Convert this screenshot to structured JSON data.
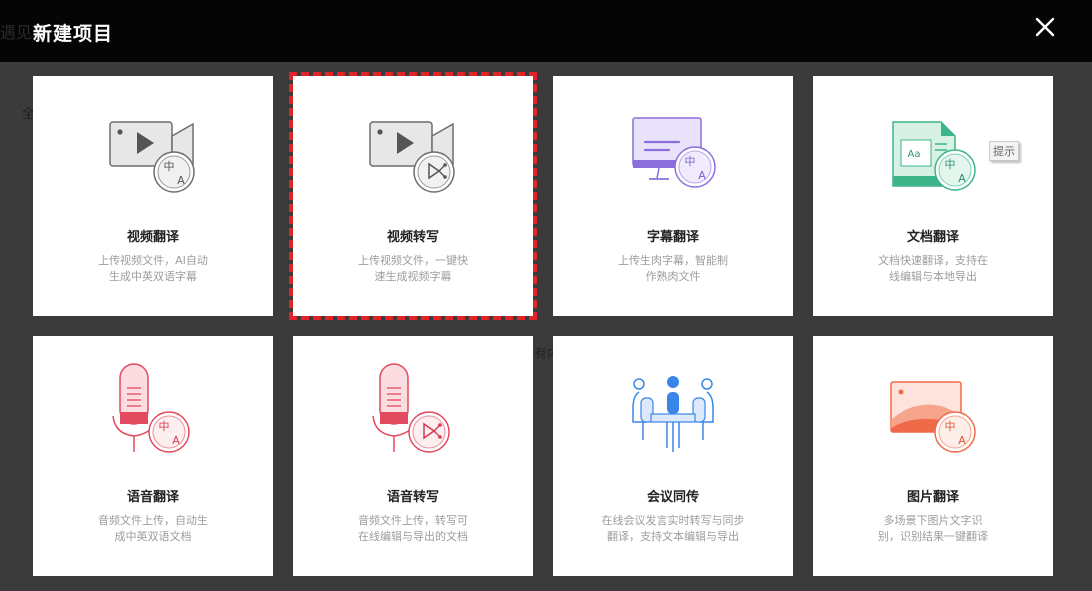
{
  "dialog": {
    "title": "新建项目",
    "close_icon": "close-icon"
  },
  "background": {
    "frag_top": "遇见外",
    "frag_left": "全",
    "frag_mid": "有内"
  },
  "cards": [
    {
      "title": "视频翻译",
      "desc_line1": "上传视频文件，AI自动",
      "desc_line2": "生成中英双语字幕",
      "icon": "video-translate-icon"
    },
    {
      "title": "视频转写",
      "desc_line1": "上传视频文件，一键快",
      "desc_line2": "速生成视频字幕",
      "icon": "video-transcribe-icon",
      "selected": true
    },
    {
      "title": "字幕翻译",
      "desc_line1": "上传生肉字幕，智能制",
      "desc_line2": "作熟肉文件",
      "icon": "subtitle-translate-icon"
    },
    {
      "title": "文档翻译",
      "desc_line1": "文档快速翻译，支持在",
      "desc_line2": "线编辑与本地导出",
      "icon": "document-translate-icon",
      "tip": "提示"
    },
    {
      "title": "语音翻译",
      "desc_line1": "音频文件上传，自动生",
      "desc_line2": "成中英双语文档",
      "icon": "audio-translate-icon"
    },
    {
      "title": "语音转写",
      "desc_line1": "音频文件上传，转写可",
      "desc_line2": "在线编辑与导出的文档",
      "icon": "audio-transcribe-icon"
    },
    {
      "title": "会议同传",
      "desc_line1": "在线会议发言实时转写与同步",
      "desc_line2": "翻译，支持文本编辑与导出",
      "icon": "meeting-interpretation-icon"
    },
    {
      "title": "图片翻译",
      "desc_line1": "多场景下图片文字识",
      "desc_line2": "别，识别结果一键翻译",
      "icon": "image-translate-icon"
    }
  ],
  "icon_glyphs": {
    "zh": "中",
    "a": "A",
    "aa": "Aa"
  },
  "colors": {
    "selected_outline": "#e0242a",
    "video_gray": "#555555",
    "subtitle_purple": "#8a6fdc",
    "doc_green": "#3db48a",
    "audio_red": "#e24a5f",
    "meeting_blue": "#3a86e8",
    "image_orange": "#f06a4a"
  }
}
